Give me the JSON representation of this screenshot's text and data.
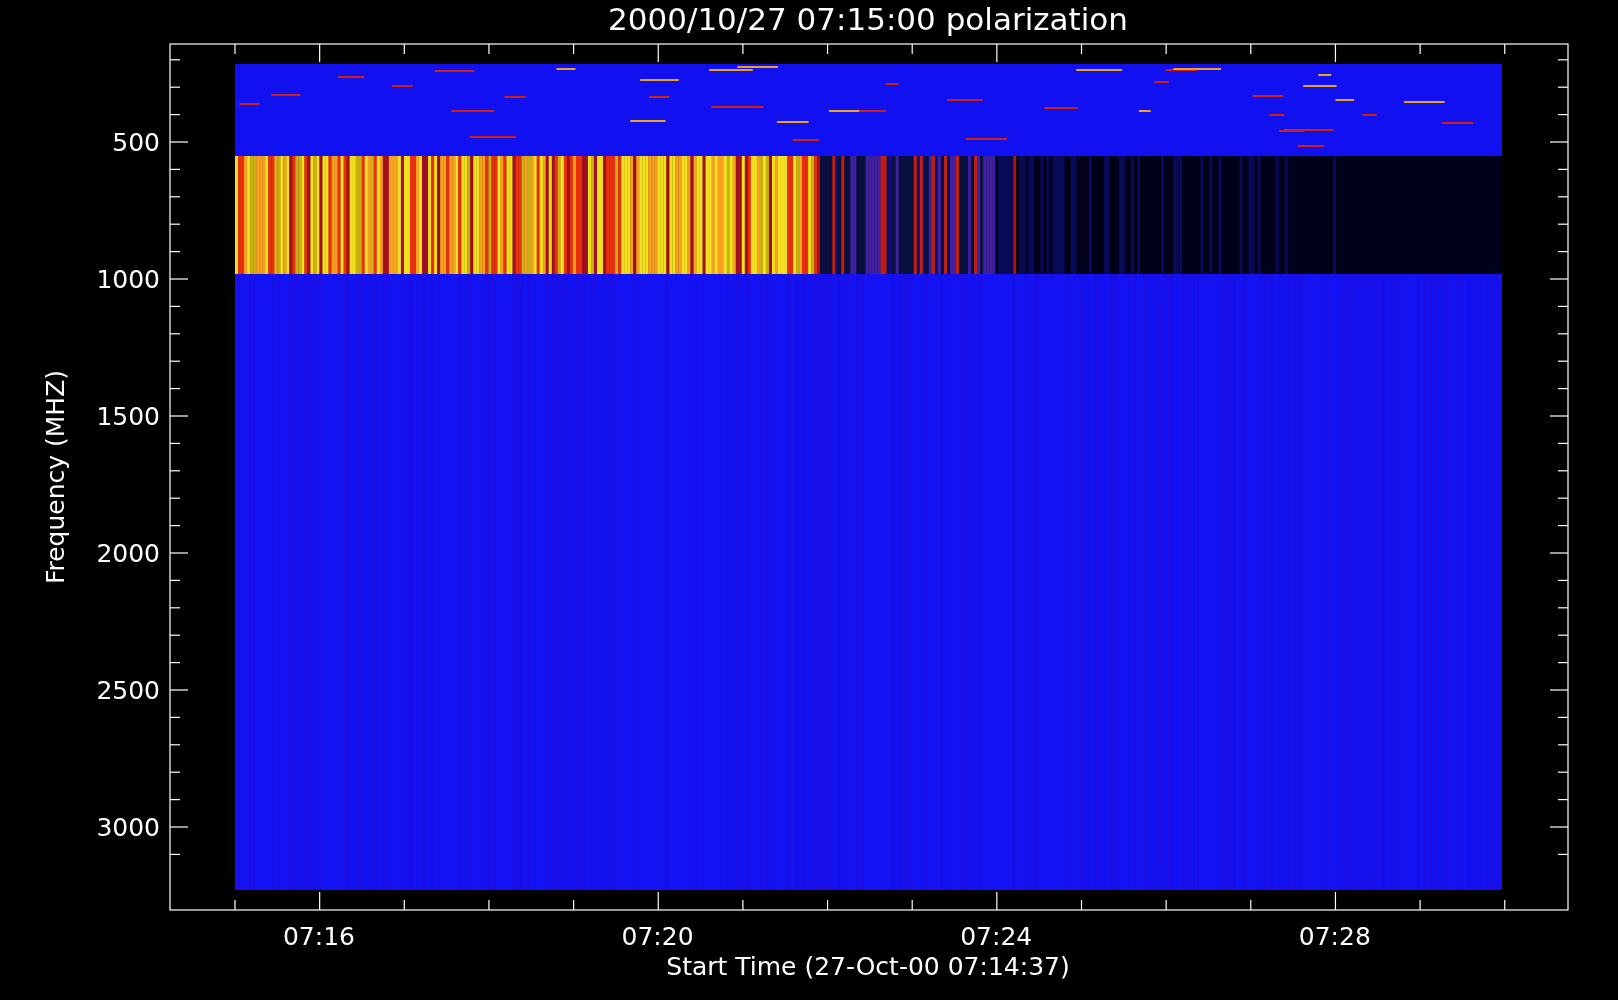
{
  "title": "2000/10/27 07:15:00 polarization",
  "plot": {
    "ylabel": "Frequency (MHZ)",
    "xlabel": "Start Time (27-Oct-00 07:14:37)",
    "yticks": [
      "500",
      "1000",
      "1500",
      "2000",
      "2500",
      "3000"
    ],
    "xticks": [
      "07:16",
      "07:20",
      "07:24",
      "07:28"
    ]
  }
}
